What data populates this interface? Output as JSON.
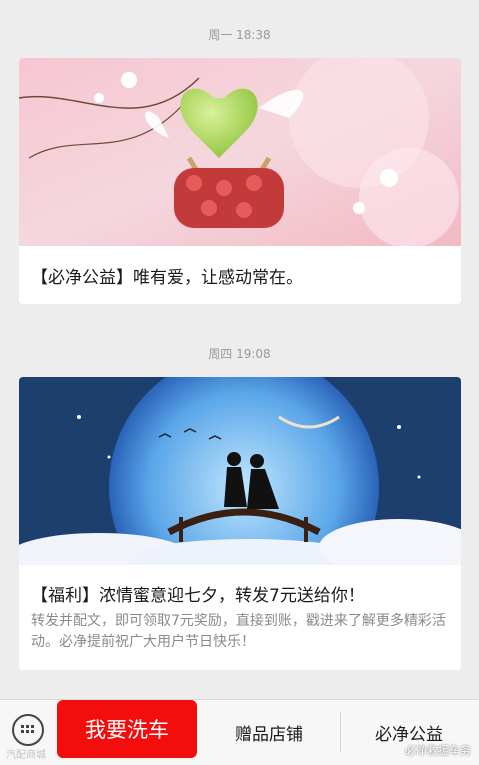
{
  "messages": [
    {
      "timestamp": "周一 18:38",
      "title": "【必净公益】唯有爱，让感动常在。"
    },
    {
      "timestamp": "周四 19:08",
      "title": "【福利】浓情蜜意迎七夕，转发7元送给你！",
      "description": "转发并配文，即可领取7元奖励，直接到账，戳进来了解更多精彩活动。必净提前祝广大用户节日快乐！"
    }
  ],
  "bottom_menu": {
    "keyboard_icon": "keyboard-icon",
    "primary": "我要洗车",
    "item2": "赠品店铺",
    "item3": "必净公益"
  },
  "watermarks": {
    "left": "汽配商城",
    "right": "必净救援车务"
  },
  "colors": {
    "primary_button": "#f40d0d",
    "background": "#ededed"
  }
}
